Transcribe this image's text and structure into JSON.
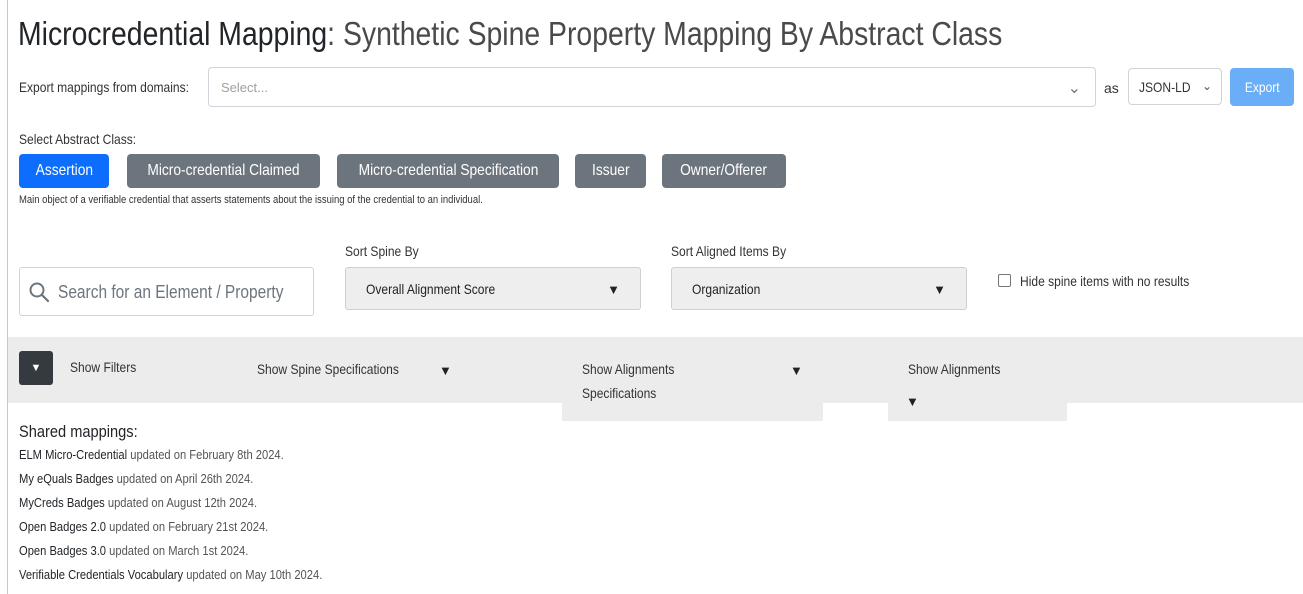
{
  "header": {
    "title_strong": "Microcredential Mapping",
    "title_rest": ": Synthetic Spine Property Mapping By Abstract Class"
  },
  "export": {
    "label": "Export mappings from domains:",
    "domains_placeholder": "Select...",
    "as_label": "as",
    "format_value": "JSON-LD",
    "button_label": "Export"
  },
  "abstract_class": {
    "label": "Select Abstract Class:",
    "options": [
      "Assertion",
      "Micro-credential Claimed",
      "Micro-credential Specification",
      "Issuer",
      "Owner/Offerer"
    ],
    "selected": "Assertion",
    "description": "Main object of a verifiable credential that asserts statements about the issuing of the credential to an individual."
  },
  "search": {
    "placeholder": "Search for an Element / Property"
  },
  "sort_spine": {
    "label": "Sort Spine By",
    "value": "Overall Alignment Score"
  },
  "sort_aligned": {
    "label": "Sort Aligned Items By",
    "value": "Organization"
  },
  "hide_empty": {
    "label": "Hide spine items with no results",
    "checked": false
  },
  "filters": {
    "show_filters": "Show Filters",
    "spine_specs": "Show Spine Specifications",
    "alignment_specs_line1": "Show Alignments",
    "alignment_specs_line2": "Specifications",
    "alignments": "Show Alignments"
  },
  "shared": {
    "title": "Shared mappings:",
    "items": [
      {
        "name": "ELM Micro-Credential",
        "updated": "updated on February 8th 2024."
      },
      {
        "name": "My eQuals Badges",
        "updated": "updated on April 26th 2024."
      },
      {
        "name": "MyCreds Badges",
        "updated": "updated on August 12th 2024."
      },
      {
        "name": "Open Badges 2.0",
        "updated": "updated on February 21st 2024."
      },
      {
        "name": "Open Badges 3.0",
        "updated": "updated on March 1st 2024."
      },
      {
        "name": "Verifiable Credentials Vocabulary",
        "updated": "updated on May 10th 2024."
      }
    ]
  },
  "icons": {
    "search": "search-icon",
    "chevron": "chevron-down-icon",
    "toggle": "caret-down-icon"
  },
  "colors": {
    "primary": "#0d6efd",
    "secondary": "#6c757d",
    "export_button": "#6aaef8",
    "filter_bar": "#ececec",
    "toggle_button": "#343a40"
  }
}
